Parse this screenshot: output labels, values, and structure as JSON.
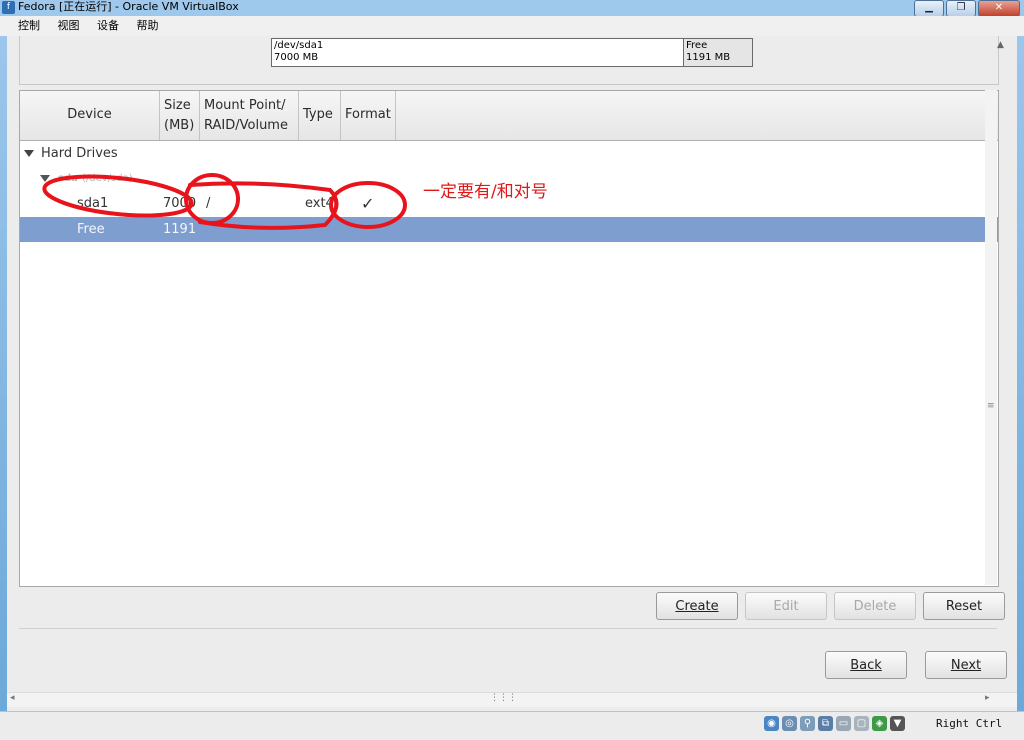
{
  "window": {
    "title": "Fedora [正在运行] - Oracle VM VirtualBox",
    "buttons": {
      "minimize": "▁",
      "restore": "❐",
      "close": "✕"
    }
  },
  "menu": [
    "控制",
    "视图",
    "设备",
    "帮助"
  ],
  "partition_bar": {
    "used": {
      "line1": "/dev/sda1",
      "line2": "7000 MB"
    },
    "free": {
      "line1": "Free",
      "line2": "1191 MB"
    }
  },
  "table": {
    "headers": {
      "device": "Device",
      "size_l1": "Size",
      "size_l2": "(MB)",
      "mount_l1": "Mount Point/",
      "mount_l2": "RAID/Volume",
      "type": "Type",
      "format": "Format"
    },
    "group": "Hard Drives",
    "disk": {
      "name": "sda",
      "path": "(/dev/sda)"
    },
    "rows": [
      {
        "device": "sda1",
        "size": "7000",
        "mount": "/",
        "type": "ext4",
        "format": "✓"
      },
      {
        "device": "Free",
        "size": "1191",
        "mount": "",
        "type": "",
        "format": ""
      }
    ]
  },
  "buttons": {
    "create": "Create",
    "edit": "Edit",
    "delete": "Delete",
    "reset": "Reset",
    "back": "Back",
    "next": "Next"
  },
  "annotation": {
    "text": "一定要有/和对号",
    "color": "#e01818"
  },
  "statusbar": {
    "host_key": "Right Ctrl"
  }
}
